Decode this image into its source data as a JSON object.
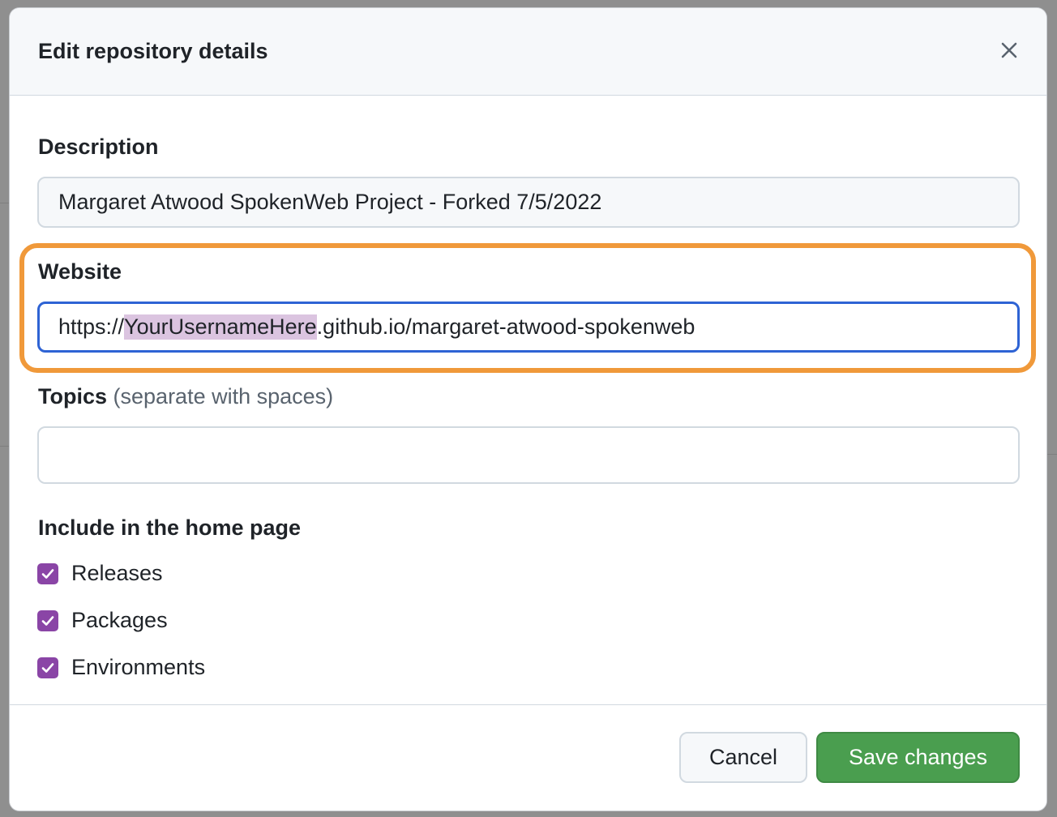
{
  "dialog": {
    "title": "Edit repository details",
    "close_icon": "close-icon"
  },
  "description": {
    "label": "Description",
    "value": "Margaret Atwood SpokenWeb Project - Forked 7/5/2022"
  },
  "website": {
    "label": "Website",
    "value_prefix": "https://",
    "value_selected": "YourUsernameHere",
    "value_suffix": ".github.io/margaret-atwood-spokenweb"
  },
  "topics": {
    "label": "Topics",
    "hint": "(separate with spaces)",
    "value": ""
  },
  "home_page": {
    "heading": "Include in the home page",
    "options": [
      {
        "label": "Releases",
        "checked": true
      },
      {
        "label": "Packages",
        "checked": true
      },
      {
        "label": "Environments",
        "checked": true
      }
    ]
  },
  "footer": {
    "cancel_label": "Cancel",
    "save_label": "Save changes"
  },
  "colors": {
    "accent_checkbox": "#8a45a6",
    "focus_border": "#2e63d4",
    "highlight_ring": "#f0993a",
    "primary_button": "#4a9e4f"
  }
}
